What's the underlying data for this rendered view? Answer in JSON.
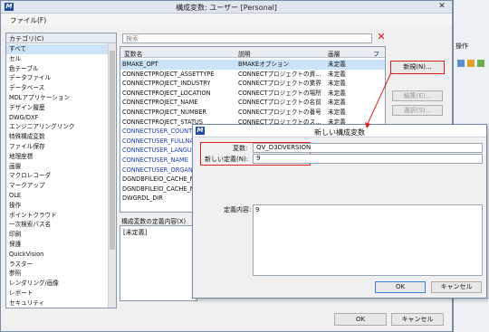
{
  "window": {
    "title": "構成変数: ユーザー [Personal]",
    "close_glyph": "✕",
    "app_icon": "M"
  },
  "menu": {
    "file": "ファイル(F)"
  },
  "categories": {
    "header": "カテゴリ(C)",
    "items": [
      "すべて",
      "セル",
      "色テーブル",
      "データファイル",
      "データベース",
      "MDLアプリケーション",
      "デザイン履歴",
      "DWG/DXF",
      "エンジニアリングリンク",
      "特殊構成変数",
      "ファイル保存",
      "地理座標",
      "画層",
      "マクロレコーダ",
      "マークアップ",
      "OLE",
      "操作",
      "ポイントクラウド",
      "一次検索パス名",
      "印刷",
      "保護",
      "QuickVision",
      "ラスター",
      "参照",
      "レンダリング/画像",
      "レポート",
      "セキュリティ"
    ]
  },
  "search": {
    "placeholder": "検索",
    "clear_glyph": "✕"
  },
  "variables": {
    "columns": [
      "変数名",
      "説明",
      "画層",
      "フ"
    ],
    "rows": [
      {
        "name": "BMAKE_OPT",
        "desc": "BMAKEオプション",
        "layer": "未定義",
        "blue": false,
        "selected": true
      },
      {
        "name": "CONNECTPROJECT_ASSETTYPE",
        "desc": "CONNECTプロジェクトの資...",
        "layer": "未定義",
        "blue": false,
        "selected": false
      },
      {
        "name": "CONNECTPROJECT_INDUSTRY",
        "desc": "CONNECTプロジェクトの業界",
        "layer": "未定義",
        "blue": false,
        "selected": false
      },
      {
        "name": "CONNECTPROJECT_LOCATION",
        "desc": "CONNECTプロジェクトの場所",
        "layer": "未定義",
        "blue": false,
        "selected": false
      },
      {
        "name": "CONNECTPROJECT_NAME",
        "desc": "CONNECTプロジェクトの名前",
        "layer": "未定義",
        "blue": false,
        "selected": false
      },
      {
        "name": "CONNECTPROJECT_NUMBER",
        "desc": "CONNECTプロジェクトの番号",
        "layer": "未定義",
        "blue": false,
        "selected": false
      },
      {
        "name": "CONNECTPROJECT_STATUS",
        "desc": "CONNECTプロジェクトのス...",
        "layer": "未定義",
        "blue": false,
        "selected": false
      },
      {
        "name": "CONNECTUSER_COUNTRY",
        "desc": "",
        "layer": "",
        "blue": true,
        "selected": false
      },
      {
        "name": "CONNECTUSER_FULLNAM",
        "desc": "",
        "layer": "",
        "blue": true,
        "selected": false
      },
      {
        "name": "CONNECTUSER_LANGUAG",
        "desc": "",
        "layer": "",
        "blue": true,
        "selected": false
      },
      {
        "name": "CONNECTUSER_NAME",
        "desc": "",
        "layer": "",
        "blue": true,
        "selected": false
      },
      {
        "name": "CONNECTUSER_ORGANIZ",
        "desc": "",
        "layer": "",
        "blue": true,
        "selected": false
      },
      {
        "name": "DGNDBFILEIO_CACHE_MA",
        "desc": "",
        "layer": "",
        "blue": false,
        "selected": false
      },
      {
        "name": "DGNDBFILEIO_CACHE_MA",
        "desc": "",
        "layer": "",
        "blue": false,
        "selected": false
      },
      {
        "name": "DWGRDL_DIR",
        "desc": "",
        "layer": "",
        "blue": false,
        "selected": false
      }
    ]
  },
  "buttons": {
    "new": "新規(N)...",
    "edit": "編集(E)...",
    "select": "選択(S)...",
    "ok": "OK",
    "cancel": "キャンセル"
  },
  "definition": {
    "label": "構成変数の定義内容(X)",
    "value": "[未定義]"
  },
  "dialog": {
    "title": "新しい構成変数",
    "var_label": "変数:",
    "var_value": "QV_D3DVERSION",
    "def_label": "新しい定義(N):",
    "def_value": "9",
    "content_label": "定義内容:",
    "content_value": "9",
    "ok": "OK",
    "cancel": "キャンセル"
  },
  "background": {
    "side_label": "操作"
  }
}
